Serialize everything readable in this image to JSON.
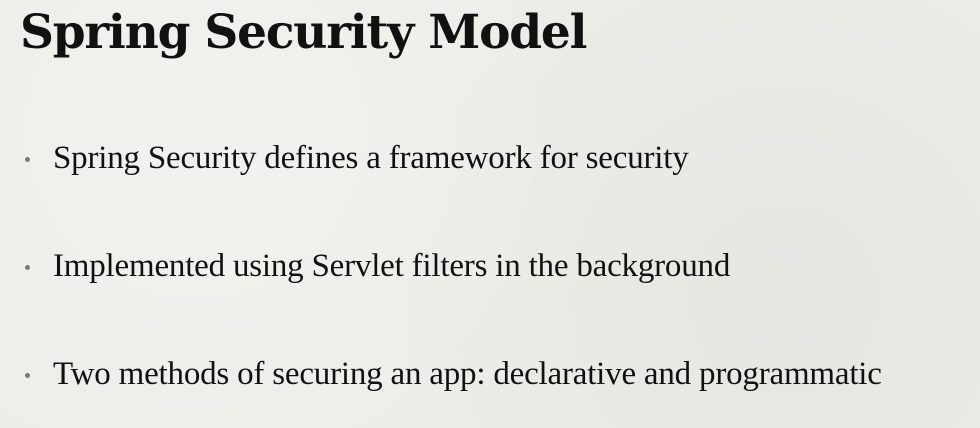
{
  "slide": {
    "title": "Spring Security Model",
    "bullets": [
      "Spring Security defines a framework for security",
      "Implemented using Servlet filters in the background",
      "Two methods of securing an app: declarative and programmatic"
    ]
  },
  "colors": {
    "background": "#efede8",
    "text": "#111111",
    "bullet": "#7a7a7a"
  }
}
